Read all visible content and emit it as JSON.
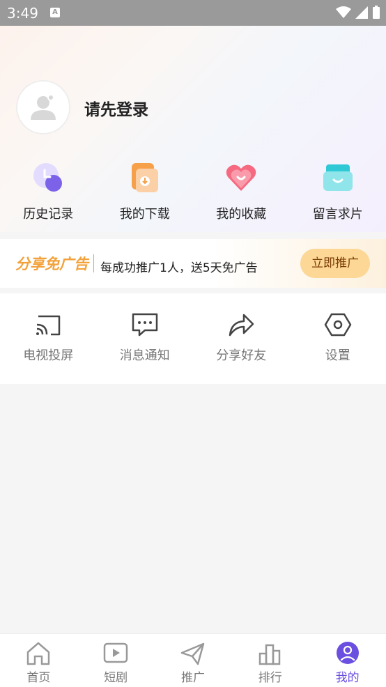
{
  "status_bar": {
    "time": "3:49",
    "notif_icon": "A"
  },
  "profile": {
    "login_prompt": "请先登录"
  },
  "quick_links": [
    {
      "label": "历史记录",
      "icon": "clock-icon"
    },
    {
      "label": "我的下载",
      "icon": "download-icon"
    },
    {
      "label": "我的收藏",
      "icon": "heart-icon"
    },
    {
      "label": "留言求片",
      "icon": "inbox-icon"
    }
  ],
  "share_banner": {
    "brand": "分享免广告",
    "description": "每成功推广1人，送5天免广告",
    "button": "立即推广"
  },
  "tools": [
    {
      "label": "电视投屏",
      "icon": "cast-icon"
    },
    {
      "label": "消息通知",
      "icon": "message-icon"
    },
    {
      "label": "分享好友",
      "icon": "share-icon"
    },
    {
      "label": "设置",
      "icon": "settings-icon"
    }
  ],
  "tabbar": [
    {
      "label": "首页",
      "icon": "home-icon"
    },
    {
      "label": "短剧",
      "icon": "play-icon"
    },
    {
      "label": "推广",
      "icon": "send-icon"
    },
    {
      "label": "排行",
      "icon": "rank-icon"
    },
    {
      "label": "我的",
      "icon": "user-icon",
      "active": true
    }
  ],
  "colors": {
    "accent": "#6a4fe0",
    "banner_orange": "#f3a13a",
    "button_bg": "#fcd795"
  }
}
